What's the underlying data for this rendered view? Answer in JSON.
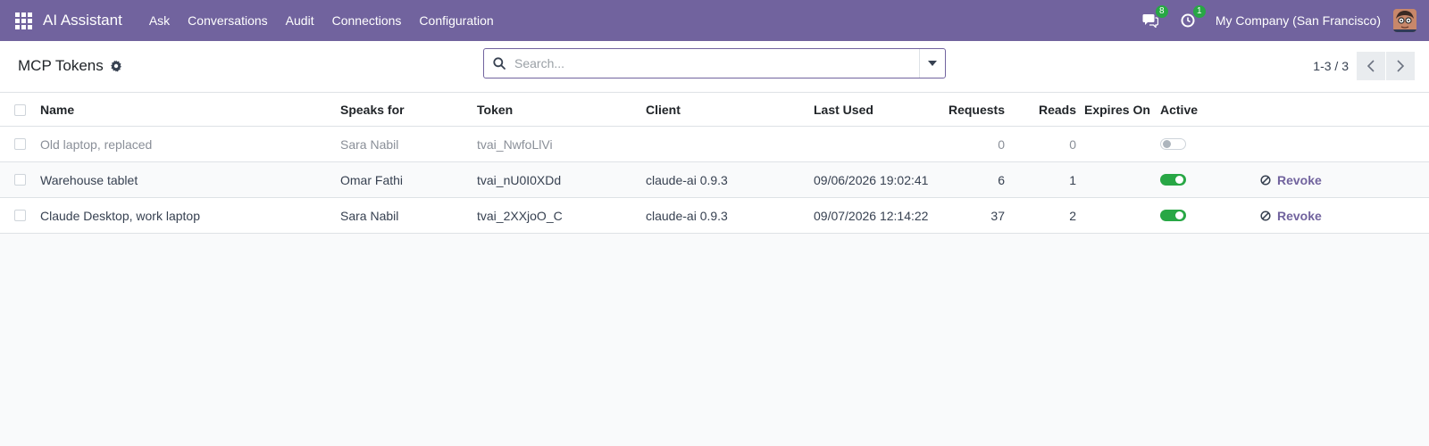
{
  "navbar": {
    "brand": "AI Assistant",
    "menu": [
      "Ask",
      "Conversations",
      "Audit",
      "Connections",
      "Configuration"
    ],
    "messages_badge": "8",
    "activity_badge": "1",
    "company": "My Company (San Francisco)",
    "accent_color": "#71639e"
  },
  "control": {
    "title": "MCP Tokens",
    "search_placeholder": "Search...",
    "pager": "1-3 / 3"
  },
  "table": {
    "columns": [
      "Name",
      "Speaks for",
      "Token",
      "Client",
      "Last Used",
      "Requests",
      "Reads",
      "Expires On",
      "Active"
    ],
    "rows": [
      {
        "name": "Old laptop, replaced",
        "speaks_for": "Sara Nabil",
        "token": "tvai_NwfoLlVi",
        "client": "",
        "last_used": "",
        "requests": "0",
        "reads": "0",
        "expires_on": "",
        "active": false,
        "action": ""
      },
      {
        "name": "Warehouse tablet",
        "speaks_for": "Omar Fathi",
        "token": "tvai_nU0I0XDd",
        "client": "claude-ai 0.9.3",
        "last_used": "09/06/2026 19:02:41",
        "requests": "6",
        "reads": "1",
        "expires_on": "",
        "active": true,
        "action": "Revoke"
      },
      {
        "name": "Claude Desktop, work laptop",
        "speaks_for": "Sara Nabil",
        "token": "tvai_2XXjoO_C",
        "client": "claude-ai 0.9.3",
        "last_used": "09/07/2026 12:14:22",
        "requests": "37",
        "reads": "2",
        "expires_on": "",
        "active": true,
        "action": "Revoke"
      }
    ]
  }
}
